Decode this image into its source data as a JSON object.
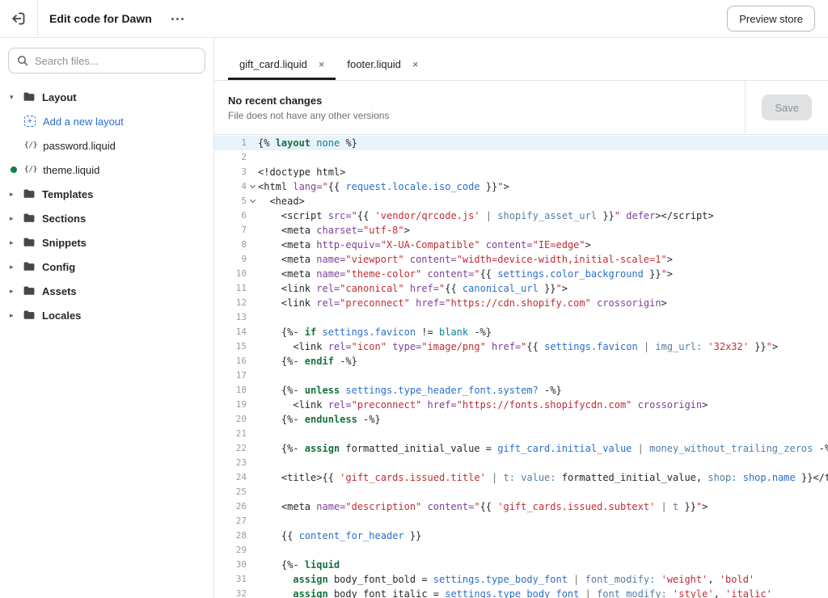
{
  "colors": {
    "accent": "#2c6ecb",
    "modified_dot": "#108043",
    "active_line_bg": "#e9f3fb",
    "tk_plain": "#24292e",
    "tk_keyword": "#15723f",
    "tk_string": "#c02d34",
    "tk_attr": "#7d3f98",
    "tk_var": "#2a6fc9",
    "tk_filter": "#527da5",
    "tk_const": "#00848e",
    "tk_pipe": "#6d7175"
  },
  "icons": {
    "caret_down": "▾",
    "caret_right": "▸",
    "file_glyph": "{/}",
    "plus": "+",
    "close": "×"
  },
  "topbar": {
    "title": "Edit code for Dawn",
    "preview_label": "Preview store"
  },
  "sidebar": {
    "search_placeholder": "Search files...",
    "tree": [
      {
        "kind": "folder",
        "label": "Layout",
        "expanded": true
      },
      {
        "kind": "action",
        "label": "Add a new layout"
      },
      {
        "kind": "file",
        "label": "password.liquid",
        "modified": false
      },
      {
        "kind": "file",
        "label": "theme.liquid",
        "modified": true
      },
      {
        "kind": "folder",
        "label": "Templates",
        "expanded": false
      },
      {
        "kind": "folder",
        "label": "Sections",
        "expanded": false
      },
      {
        "kind": "folder",
        "label": "Snippets",
        "expanded": false
      },
      {
        "kind": "folder",
        "label": "Config",
        "expanded": false
      },
      {
        "kind": "folder",
        "label": "Assets",
        "expanded": false
      },
      {
        "kind": "folder",
        "label": "Locales",
        "expanded": false
      }
    ]
  },
  "tabs": [
    {
      "label": "gift_card.liquid",
      "active": true
    },
    {
      "label": "footer.liquid",
      "active": false
    }
  ],
  "version_bar": {
    "title": "No recent changes",
    "subtitle": "File does not have any other versions",
    "save_label": "Save"
  },
  "editor": {
    "active_line": 1,
    "fold_lines": [
      4,
      5
    ],
    "lines": [
      [
        [
          "p",
          "{% "
        ],
        [
          "k",
          "layout"
        ],
        [
          "p",
          " "
        ],
        [
          "c",
          "none"
        ],
        [
          "p",
          " %}"
        ]
      ],
      [],
      [
        [
          "p",
          "<!doctype html>"
        ]
      ],
      [
        [
          "p",
          "<html "
        ],
        [
          "a",
          "lang="
        ],
        [
          "s",
          "\""
        ],
        [
          "p",
          "{{ "
        ],
        [
          "v",
          "request.locale.iso_code"
        ],
        [
          "p",
          " }}"
        ],
        [
          "s",
          "\""
        ],
        [
          "p",
          ">"
        ]
      ],
      [
        [
          "p",
          "  <head>"
        ]
      ],
      [
        [
          "p",
          "    <script "
        ],
        [
          "a",
          "src="
        ],
        [
          "s",
          "\""
        ],
        [
          "p",
          "{{ "
        ],
        [
          "s",
          "'vendor/qrcode.js'"
        ],
        [
          "i",
          " | "
        ],
        [
          "f",
          "shopify_asset_url"
        ],
        [
          "p",
          " }}"
        ],
        [
          "s",
          "\""
        ],
        [
          "a",
          " defer"
        ],
        [
          "p",
          "></script>"
        ]
      ],
      [
        [
          "p",
          "    <meta "
        ],
        [
          "a",
          "charset="
        ],
        [
          "s",
          "\"utf-8\""
        ],
        [
          "p",
          ">"
        ]
      ],
      [
        [
          "p",
          "    <meta "
        ],
        [
          "a",
          "http-equiv="
        ],
        [
          "s",
          "\"X-UA-Compatible\""
        ],
        [
          "p",
          " "
        ],
        [
          "a",
          "content="
        ],
        [
          "s",
          "\"IE=edge\""
        ],
        [
          "p",
          ">"
        ]
      ],
      [
        [
          "p",
          "    <meta "
        ],
        [
          "a",
          "name="
        ],
        [
          "s",
          "\"viewport\""
        ],
        [
          "p",
          " "
        ],
        [
          "a",
          "content="
        ],
        [
          "s",
          "\"width=device-width,initial-scale=1\""
        ],
        [
          "p",
          ">"
        ]
      ],
      [
        [
          "p",
          "    <meta "
        ],
        [
          "a",
          "name="
        ],
        [
          "s",
          "\"theme-color\""
        ],
        [
          "p",
          " "
        ],
        [
          "a",
          "content="
        ],
        [
          "s",
          "\""
        ],
        [
          "p",
          "{{ "
        ],
        [
          "v",
          "settings.color_background"
        ],
        [
          "p",
          " }}"
        ],
        [
          "s",
          "\""
        ],
        [
          "p",
          ">"
        ]
      ],
      [
        [
          "p",
          "    <link "
        ],
        [
          "a",
          "rel="
        ],
        [
          "s",
          "\"canonical\""
        ],
        [
          "p",
          " "
        ],
        [
          "a",
          "href="
        ],
        [
          "s",
          "\""
        ],
        [
          "p",
          "{{ "
        ],
        [
          "v",
          "canonical_url"
        ],
        [
          "p",
          " }}"
        ],
        [
          "s",
          "\""
        ],
        [
          "p",
          ">"
        ]
      ],
      [
        [
          "p",
          "    <link "
        ],
        [
          "a",
          "rel="
        ],
        [
          "s",
          "\"preconnect\""
        ],
        [
          "p",
          " "
        ],
        [
          "a",
          "href="
        ],
        [
          "s",
          "\"https://cdn.shopify.com\""
        ],
        [
          "a",
          " crossorigin"
        ],
        [
          "p",
          ">"
        ]
      ],
      [],
      [
        [
          "p",
          "    {%- "
        ],
        [
          "k",
          "if"
        ],
        [
          "p",
          " "
        ],
        [
          "v",
          "settings.favicon"
        ],
        [
          "p",
          " != "
        ],
        [
          "c",
          "blank"
        ],
        [
          "p",
          " -%}"
        ]
      ],
      [
        [
          "p",
          "      <link "
        ],
        [
          "a",
          "rel="
        ],
        [
          "s",
          "\"icon\""
        ],
        [
          "p",
          " "
        ],
        [
          "a",
          "type="
        ],
        [
          "s",
          "\"image/png\""
        ],
        [
          "p",
          " "
        ],
        [
          "a",
          "href="
        ],
        [
          "s",
          "\""
        ],
        [
          "p",
          "{{ "
        ],
        [
          "v",
          "settings.favicon"
        ],
        [
          "i",
          " | "
        ],
        [
          "f",
          "img_url:"
        ],
        [
          "p",
          " "
        ],
        [
          "s",
          "'32x32'"
        ],
        [
          "p",
          " }}"
        ],
        [
          "s",
          "\""
        ],
        [
          "p",
          ">"
        ]
      ],
      [
        [
          "p",
          "    {%- "
        ],
        [
          "k",
          "endif"
        ],
        [
          "p",
          " -%}"
        ]
      ],
      [],
      [
        [
          "p",
          "    {%- "
        ],
        [
          "k",
          "unless"
        ],
        [
          "p",
          " "
        ],
        [
          "v",
          "settings.type_header_font.system?"
        ],
        [
          "p",
          " -%}"
        ]
      ],
      [
        [
          "p",
          "      <link "
        ],
        [
          "a",
          "rel="
        ],
        [
          "s",
          "\"preconnect\""
        ],
        [
          "p",
          " "
        ],
        [
          "a",
          "href="
        ],
        [
          "s",
          "\"https://fonts.shopifycdn.com\""
        ],
        [
          "a",
          " crossorigin"
        ],
        [
          "p",
          ">"
        ]
      ],
      [
        [
          "p",
          "    {%- "
        ],
        [
          "k",
          "endunless"
        ],
        [
          "p",
          " -%}"
        ]
      ],
      [],
      [
        [
          "p",
          "    {%- "
        ],
        [
          "k",
          "assign"
        ],
        [
          "p",
          " formatted_initial_value = "
        ],
        [
          "v",
          "gift_card.initial_value"
        ],
        [
          "i",
          " | "
        ],
        [
          "f",
          "money_without_trailing_zeros"
        ],
        [
          "p",
          " -%}"
        ]
      ],
      [],
      [
        [
          "p",
          "    <title>{{ "
        ],
        [
          "s",
          "'gift_cards.issued.title'"
        ],
        [
          "i",
          " | "
        ],
        [
          "f",
          "t:"
        ],
        [
          "p",
          " "
        ],
        [
          "f",
          "value:"
        ],
        [
          "p",
          " formatted_initial_value, "
        ],
        [
          "f",
          "shop:"
        ],
        [
          "p",
          " "
        ],
        [
          "v",
          "shop.name"
        ],
        [
          "p",
          " }}</title>"
        ]
      ],
      [],
      [
        [
          "p",
          "    <meta "
        ],
        [
          "a",
          "name="
        ],
        [
          "s",
          "\"description\""
        ],
        [
          "p",
          " "
        ],
        [
          "a",
          "content="
        ],
        [
          "s",
          "\""
        ],
        [
          "p",
          "{{ "
        ],
        [
          "s",
          "'gift_cards.issued.subtext'"
        ],
        [
          "i",
          " | "
        ],
        [
          "f",
          "t"
        ],
        [
          "p",
          " }}"
        ],
        [
          "s",
          "\""
        ],
        [
          "p",
          ">"
        ]
      ],
      [],
      [
        [
          "p",
          "    {{ "
        ],
        [
          "v",
          "content_for_header"
        ],
        [
          "p",
          " }}"
        ]
      ],
      [],
      [
        [
          "p",
          "    {%- "
        ],
        [
          "k",
          "liquid"
        ]
      ],
      [
        [
          "p",
          "      "
        ],
        [
          "k",
          "assign"
        ],
        [
          "p",
          " body_font_bold = "
        ],
        [
          "v",
          "settings.type_body_font"
        ],
        [
          "i",
          " | "
        ],
        [
          "f",
          "font_modify:"
        ],
        [
          "p",
          " "
        ],
        [
          "s",
          "'weight'"
        ],
        [
          "p",
          ", "
        ],
        [
          "s",
          "'bold'"
        ]
      ],
      [
        [
          "p",
          "      "
        ],
        [
          "k",
          "assign"
        ],
        [
          "p",
          " body_font_italic = "
        ],
        [
          "v",
          "settings.type_body_font"
        ],
        [
          "i",
          " | "
        ],
        [
          "f",
          "font_modify:"
        ],
        [
          "p",
          " "
        ],
        [
          "s",
          "'style'"
        ],
        [
          "p",
          ", "
        ],
        [
          "s",
          "'italic'"
        ]
      ]
    ]
  }
}
